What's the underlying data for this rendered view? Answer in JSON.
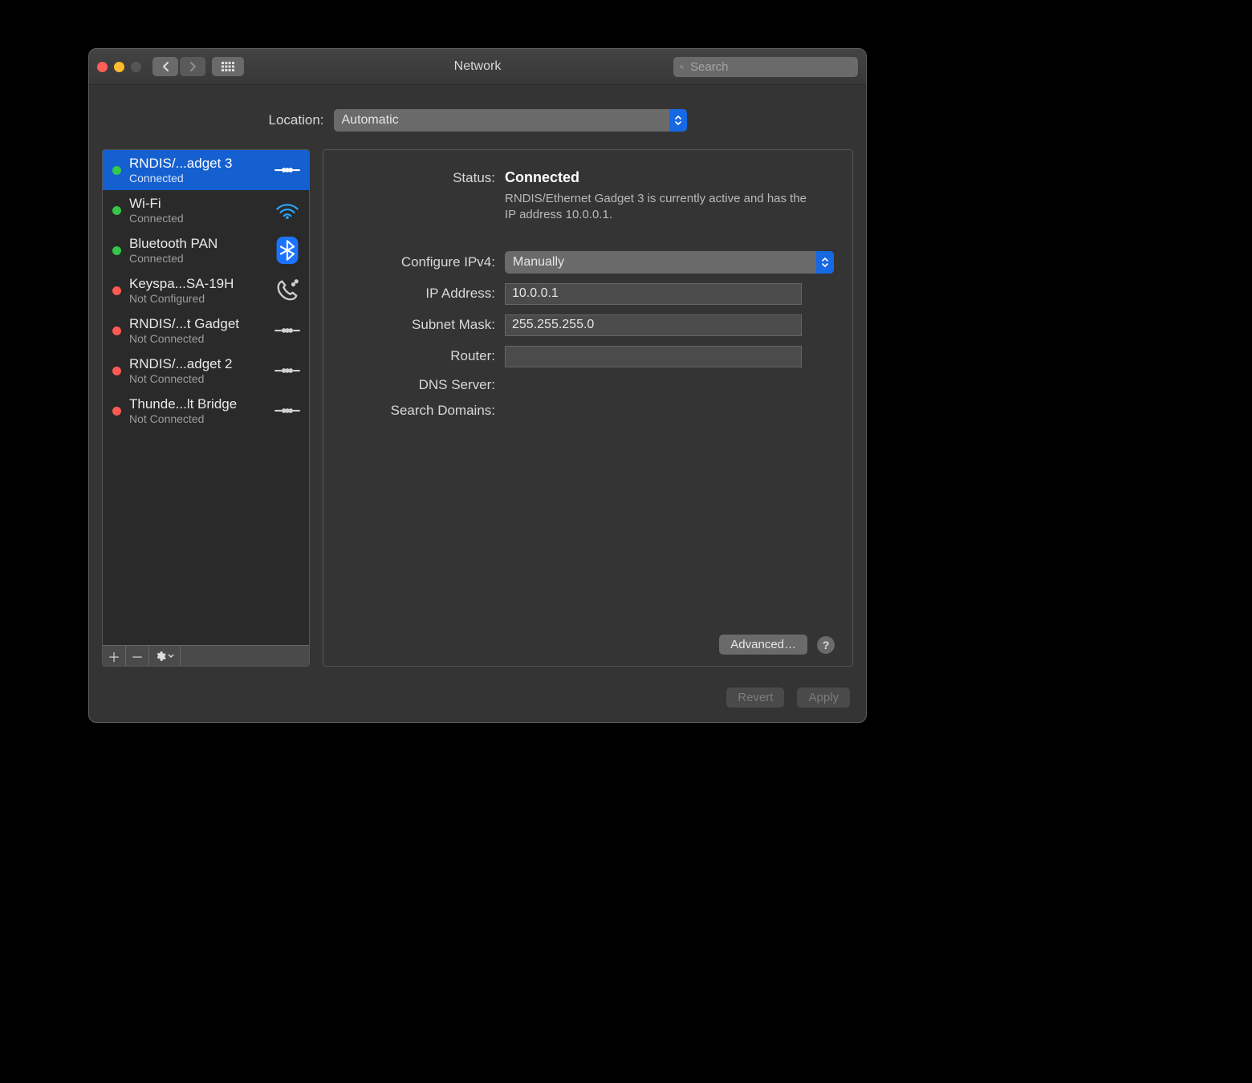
{
  "window_title": "Network",
  "search": {
    "placeholder": "Search",
    "value": ""
  },
  "location": {
    "label": "Location:",
    "selected": "Automatic"
  },
  "interfaces": [
    {
      "name": "RNDIS/...adget 3",
      "status": "Connected",
      "status_class": "green",
      "icon": "ethernet",
      "selected": true
    },
    {
      "name": "Wi-Fi",
      "status": "Connected",
      "status_class": "green",
      "icon": "wifi",
      "selected": false
    },
    {
      "name": "Bluetooth PAN",
      "status": "Connected",
      "status_class": "green",
      "icon": "bluetooth",
      "selected": false
    },
    {
      "name": "Keyspa...SA-19H",
      "status": "Not Configured",
      "status_class": "red",
      "icon": "phone",
      "selected": false
    },
    {
      "name": "RNDIS/...t Gadget",
      "status": "Not Connected",
      "status_class": "red",
      "icon": "ethernet",
      "selected": false
    },
    {
      "name": "RNDIS/...adget 2",
      "status": "Not Connected",
      "status_class": "red",
      "icon": "ethernet",
      "selected": false
    },
    {
      "name": "Thunde...lt Bridge",
      "status": "Not Connected",
      "status_class": "red",
      "icon": "ethernet",
      "selected": false
    }
  ],
  "detail": {
    "status_label": "Status:",
    "status_value": "Connected",
    "status_description": "RNDIS/Ethernet Gadget 3 is currently active and has the IP address 10.0.0.1.",
    "configure_label": "Configure IPv4:",
    "configure_value": "Manually",
    "ip_label": "IP Address:",
    "ip_value": "10.0.0.1",
    "subnet_label": "Subnet Mask:",
    "subnet_value": "255.255.255.0",
    "router_label": "Router:",
    "router_value": "",
    "dns_label": "DNS Server:",
    "dns_value": "",
    "domains_label": "Search Domains:",
    "domains_value": "",
    "advanced_button": "Advanced…"
  },
  "footer": {
    "revert": "Revert",
    "apply": "Apply"
  }
}
